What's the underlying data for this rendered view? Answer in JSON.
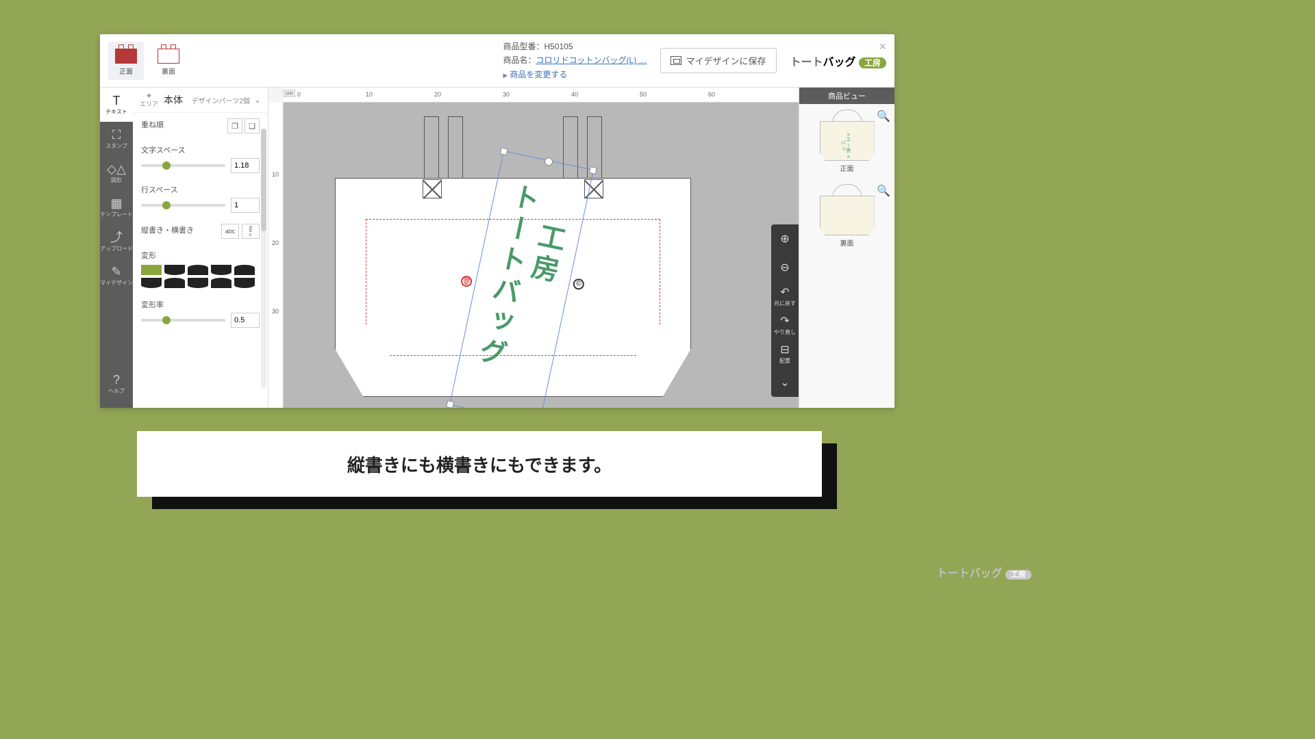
{
  "header": {
    "tabs": {
      "front": "正面",
      "back": "裏面"
    },
    "model_label": "商品型番：",
    "model": "H50105",
    "name_label": "商品名：",
    "name": "コロリドコットンバッグ(L) …",
    "change": "商品を変更する",
    "save": "マイデザインに保存",
    "logo_a": "トート",
    "logo_b": "バッグ",
    "logo_pill": "工房"
  },
  "tools": {
    "text": "テキスト",
    "stamp": "スタンプ",
    "shape": "図形",
    "template": "テンプレート",
    "upload": "アップロード",
    "mydesign": "マイデザイン",
    "help": "ヘルプ"
  },
  "panel": {
    "area": "エリア",
    "title": "本体",
    "parts": "デザインパーツ2個",
    "order": "重ね順",
    "charspace_lbl": "文字スペース",
    "charspace": "1.18",
    "linespace_lbl": "行スペース",
    "linespace": "1",
    "direction_lbl": "縦書き・横書き",
    "dir_h": "abc",
    "dir_v": "a\nb\nc",
    "deform_lbl": "変形",
    "rate_lbl": "変形率",
    "rate": "0.5"
  },
  "ruler": {
    "unit": "cm",
    "marks_h": [
      "0",
      "10",
      "20",
      "30",
      "40",
      "50",
      "60"
    ],
    "marks_v": [
      "10",
      "20",
      "30"
    ]
  },
  "canvas_text": {
    "col1": "トートバッグ",
    "col2": "工房"
  },
  "canvas_tools": {
    "zoomin": "",
    "zoomout": "",
    "undo": "元に戻す",
    "redo": "やり直し",
    "align": "配置"
  },
  "preview": {
    "title": "商品ビュー",
    "front": "正面",
    "back": "裏面",
    "mini": "トエ\nー房\nトバ\nッ"
  },
  "caption": "縦書きにも横書きにもできます。",
  "footer": {
    "a": "トート",
    "b": "バッグ",
    "pill": "工房"
  }
}
